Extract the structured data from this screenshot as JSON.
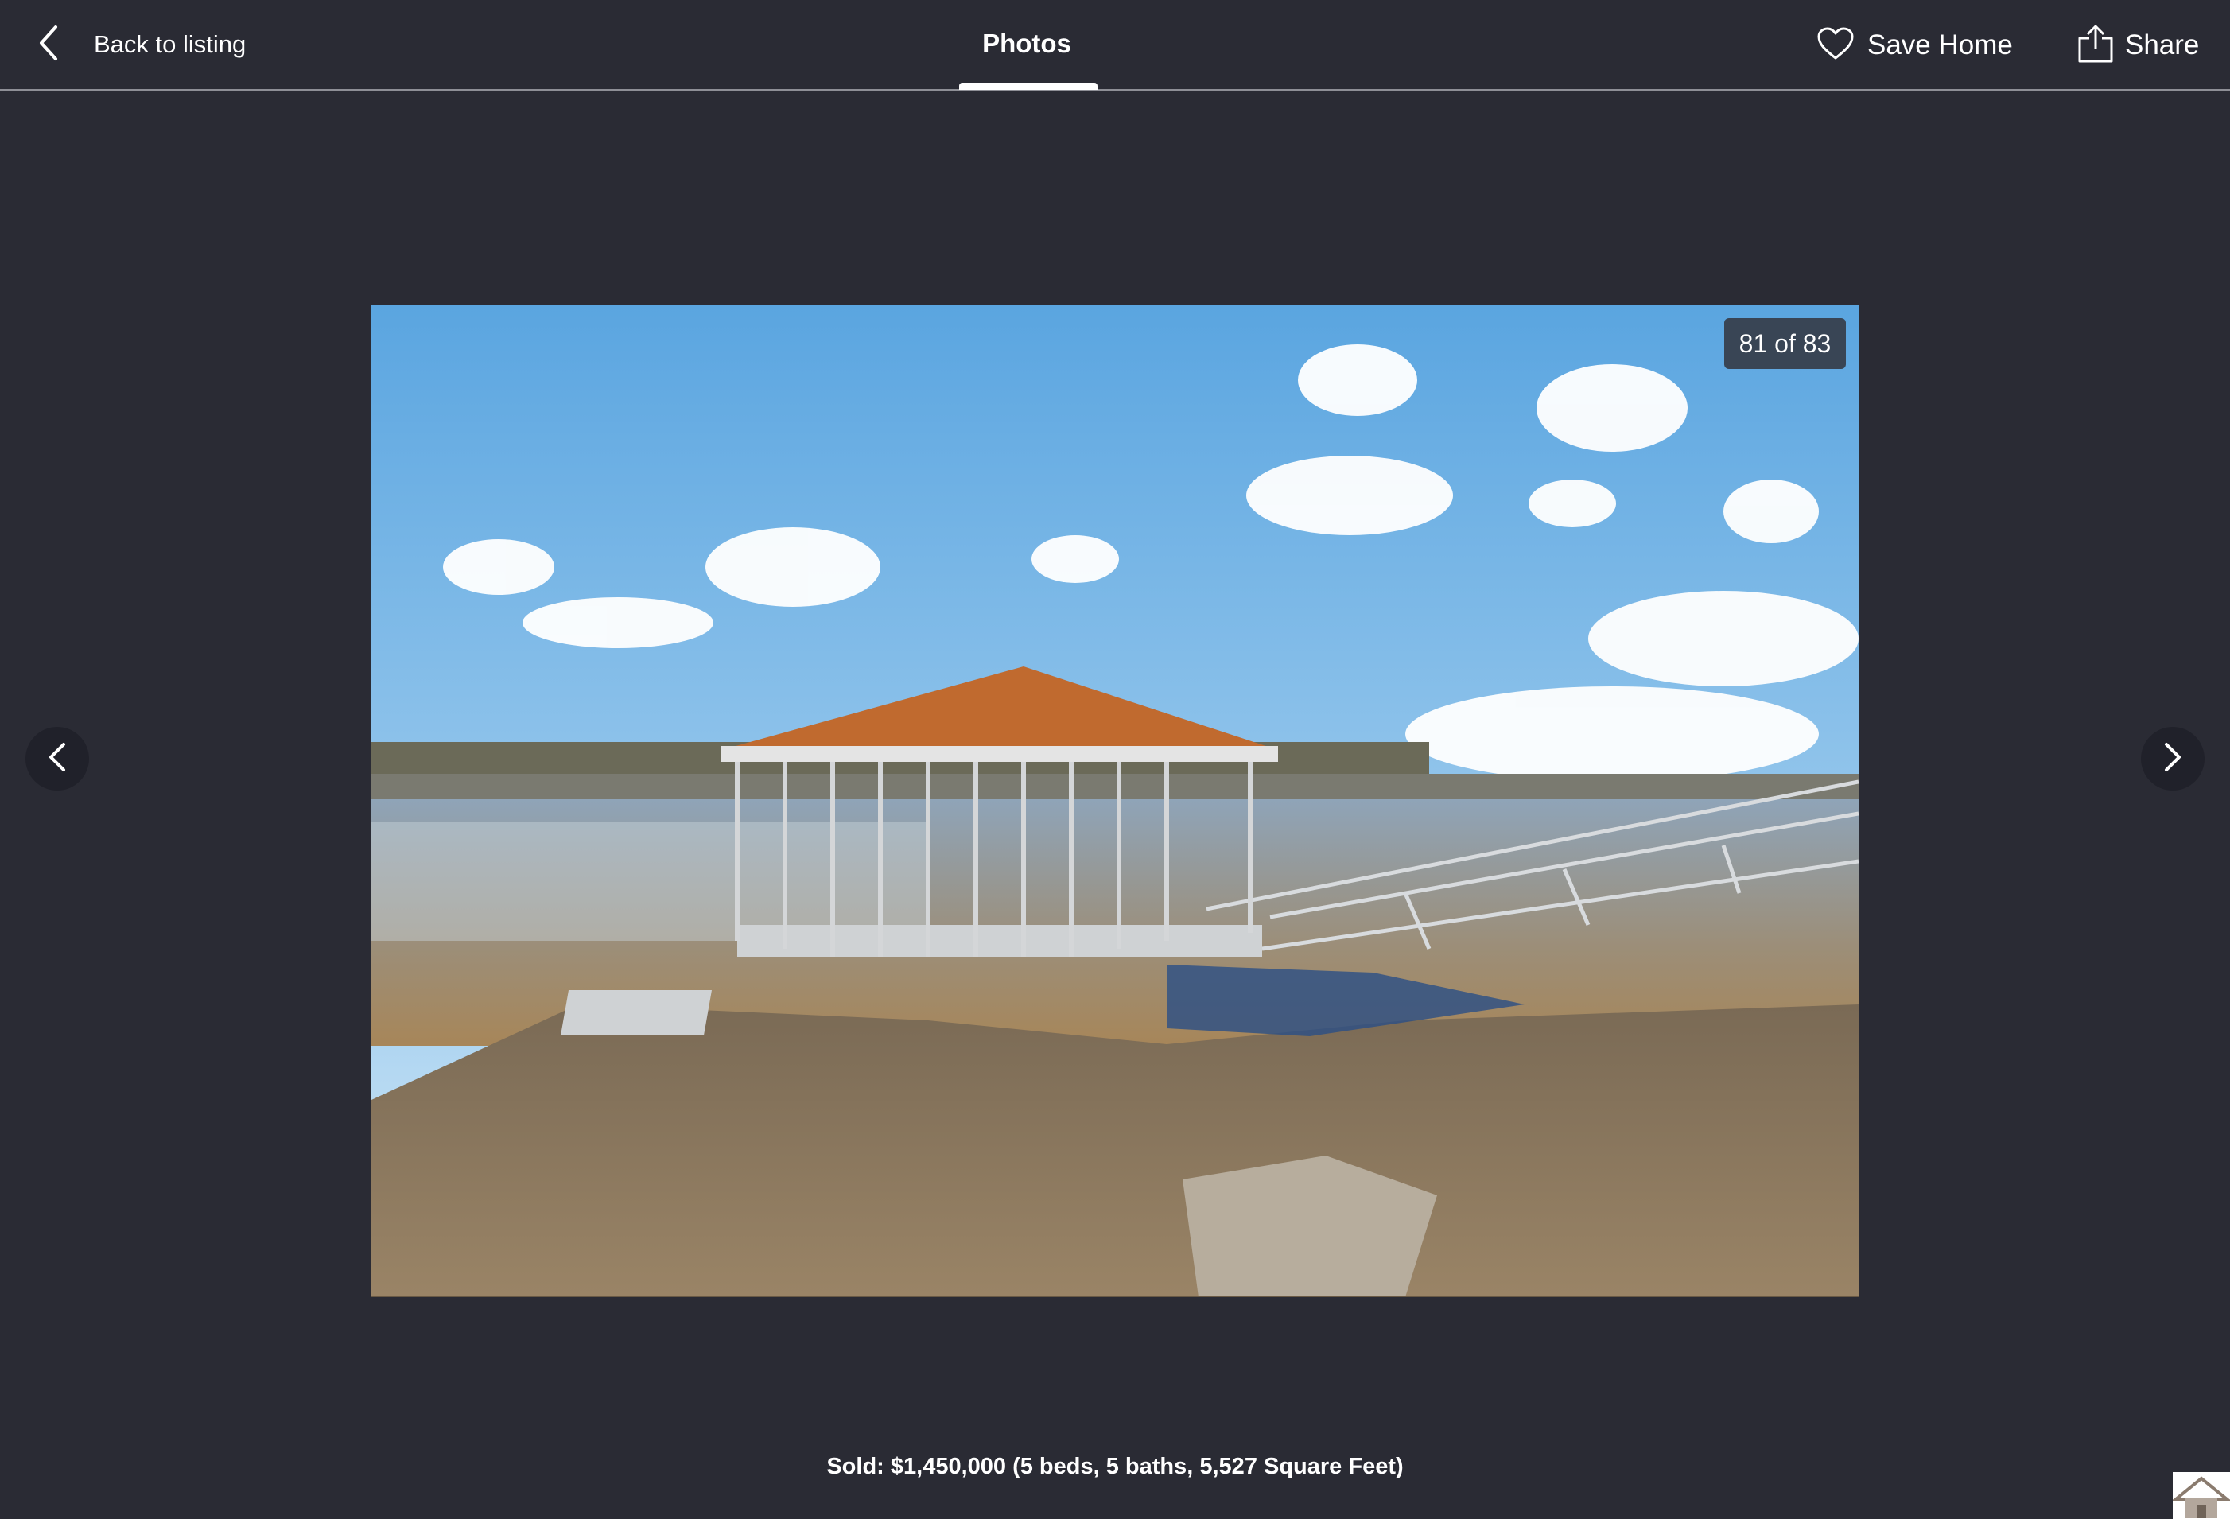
{
  "header": {
    "back_label": "Back to listing",
    "title": "Photos",
    "save_label": "Save Home",
    "share_label": "Share"
  },
  "photo": {
    "counter": "81 of 83",
    "current": 81,
    "total": 83
  },
  "caption": "Sold: $1,450,000 (5 beds, 5 baths, 5,527 Square Feet)",
  "icons": {
    "back": "chevron-left-icon",
    "save": "heart-icon",
    "share": "share-icon",
    "prev": "chevron-left-icon",
    "next": "chevron-right-icon",
    "logo": "house-logo-icon"
  },
  "colors": {
    "background": "#2a2b34",
    "text": "#ffffff",
    "divider": "#8e8f96"
  }
}
